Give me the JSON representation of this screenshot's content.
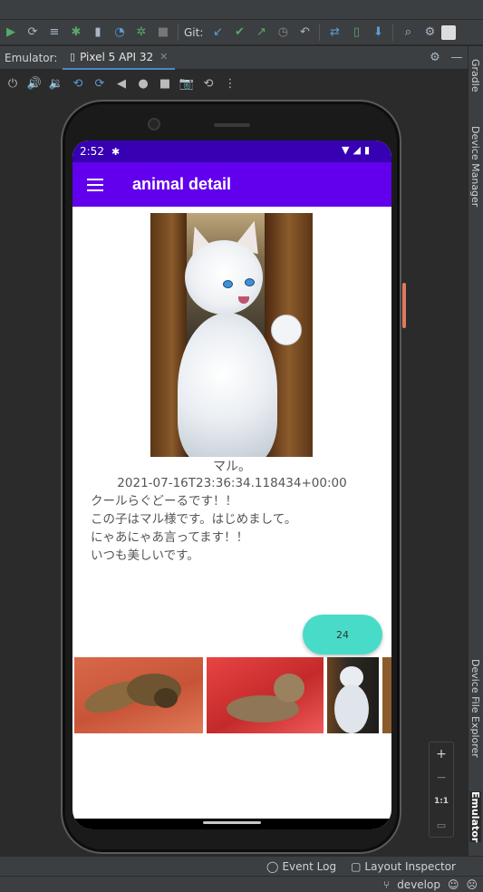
{
  "ide": {
    "git_label": "Git:",
    "emulator_label": "Emulator:",
    "device_tab": "Pixel 5 API 32",
    "right_tabs": {
      "gradle": "Gradle",
      "device_manager": "Device Manager",
      "device_file_explorer": "Device File Explorer",
      "emulator": "Emulator"
    },
    "bottom_tools": {
      "event_log": "Event Log",
      "layout_inspector": "Layout Inspector"
    },
    "status": {
      "branch": "develop"
    },
    "zoom": {
      "zoom_in": "+",
      "zoom_out": "−",
      "actual_size": "1:1"
    }
  },
  "device": {
    "time": "2:52",
    "app_title": "animal detail",
    "pet_name": "マル。",
    "timestamp": "2021-07-16T23:36:34.118434+00:00",
    "description_lines": [
      "クールらぐどーるです！！",
      "この子はマル様です。はじめまして。",
      "にゃあにゃあ言ってます！！",
      "いつも美しいです。"
    ],
    "fab_label": "24"
  },
  "colors": {
    "status_bar": "#3700b3",
    "app_bar": "#6200ee",
    "fab": "#48dcc8",
    "ide_bg": "#2b2b2b",
    "ide_panel": "#3c3f41"
  },
  "icons": {
    "toolbar": [
      "run-icon",
      "rerun-icon",
      "logcat-icon",
      "debug-icon",
      "attach-icon",
      "profile-icon",
      "apply-changes-icon",
      "stop-icon"
    ],
    "git": [
      "git-update-icon",
      "git-commit-icon",
      "git-push-icon",
      "git-history-icon",
      "git-rollback-icon"
    ],
    "right": [
      "sync-icon",
      "avd-icon",
      "sdk-icon",
      "search-icon",
      "settings-icon"
    ]
  }
}
